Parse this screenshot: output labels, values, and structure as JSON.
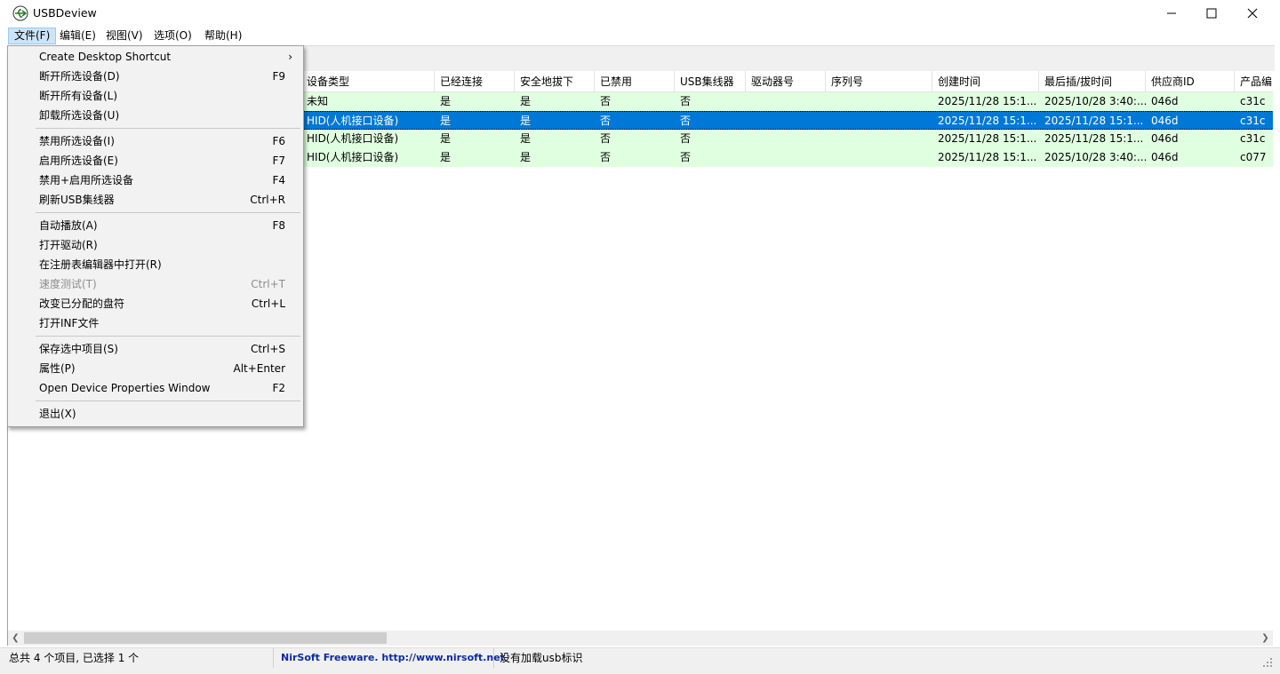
{
  "window": {
    "title": "USBDeview"
  },
  "menubar": [
    {
      "label": "文件(F)"
    },
    {
      "label": "编辑(E)"
    },
    {
      "label": "视图(V)"
    },
    {
      "label": "选项(O)"
    },
    {
      "label": "帮助(H)"
    }
  ],
  "file_menu": {
    "items": [
      {
        "label": "Create Desktop Shortcut",
        "key": ""
      },
      {
        "label": "断开所选设备(D)",
        "key": "F9"
      },
      {
        "label": "断开所有设备(L)",
        "key": ""
      },
      {
        "label": "卸载所选设备(U)",
        "key": ""
      },
      {
        "label": "禁用所选设备(I)",
        "key": "F6"
      },
      {
        "label": "启用所选设备(E)",
        "key": "F7"
      },
      {
        "label": "禁用+启用所选设备",
        "key": "F4"
      },
      {
        "label": "刷新USB集线器",
        "key": "Ctrl+R"
      },
      {
        "label": "自动播放(A)",
        "key": "F8"
      },
      {
        "label": "打开驱动(R)",
        "key": ""
      },
      {
        "label": "在注册表编辑器中打开(R)",
        "key": ""
      },
      {
        "label": "速度测试(T)",
        "key": "Ctrl+T"
      },
      {
        "label": "改变已分配的盘符",
        "key": "Ctrl+L"
      },
      {
        "label": "打开INF文件",
        "key": ""
      },
      {
        "label": "保存选中项目(S)",
        "key": "Ctrl+S"
      },
      {
        "label": "属性(P)",
        "key": "Alt+Enter"
      },
      {
        "label": "Open Device Properties Window",
        "key": "F2"
      },
      {
        "label": "退出(X)",
        "key": ""
      }
    ]
  },
  "table": {
    "columns": [
      "设备类型",
      "已经连接",
      "安全地拔下",
      "已禁用",
      "USB集线器",
      "驱动器号",
      "序列号",
      "创建时间",
      "最后插/拔时间",
      "供应商ID",
      "产品编"
    ],
    "rows": [
      [
        "未知",
        "是",
        "是",
        "否",
        "否",
        "",
        "",
        "2025/11/28 15:1...",
        "2025/10/28 3:40:...",
        "046d",
        "c31c"
      ],
      [
        "HID(人机接口设备)",
        "是",
        "是",
        "否",
        "否",
        "",
        "",
        "2025/11/28 15:1...",
        "2025/11/28 15:1...",
        "046d",
        "c31c"
      ],
      [
        "HID(人机接口设备)",
        "是",
        "是",
        "否",
        "否",
        "",
        "",
        "2025/11/28 15:1...",
        "2025/11/28 15:1...",
        "046d",
        "c31c"
      ],
      [
        "HID(人机接口设备)",
        "是",
        "是",
        "否",
        "否",
        "",
        "",
        "2025/11/28 15:1...",
        "2025/10/28 3:40:...",
        "046d",
        "c077"
      ]
    ],
    "selected_row": 1
  },
  "statusbar": {
    "count": "总共 4 个项目, 已选择 1 个",
    "link": "NirSoft Freeware.  http://www.nirsoft.net",
    "message": "没有加载usb标识"
  },
  "colors": {
    "row_bg": "#e0ffe0",
    "selected_bg": "#0078d7",
    "link": "#0a2aa8"
  }
}
